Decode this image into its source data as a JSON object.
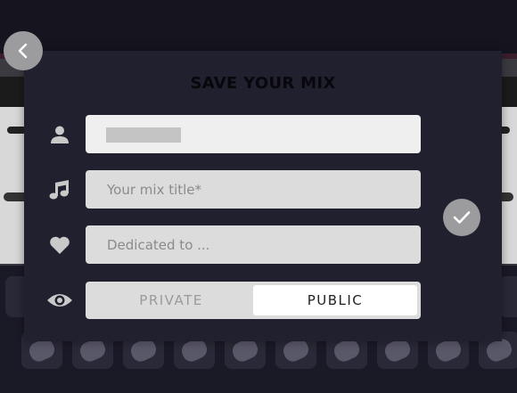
{
  "modal": {
    "title": "SAVE YOUR MIX",
    "name_value": "",
    "mix_title_placeholder": "Your mix title*",
    "dedication_placeholder": "Dedicated to ...",
    "visibility": {
      "options": [
        "PRIVATE",
        "PUBLIC"
      ],
      "selected": "PUBLIC"
    }
  },
  "icons": {
    "back": "chevron-left-icon",
    "user": "user-icon",
    "music": "music-note-icon",
    "heart": "heart-icon",
    "eye": "eye-icon",
    "confirm": "check-icon"
  },
  "colors": {
    "modal_bg": "#20202f",
    "button_gray": "#9c9c9f",
    "field_bg": "#dcdcdc",
    "icon_color": "#c9c9c9"
  }
}
